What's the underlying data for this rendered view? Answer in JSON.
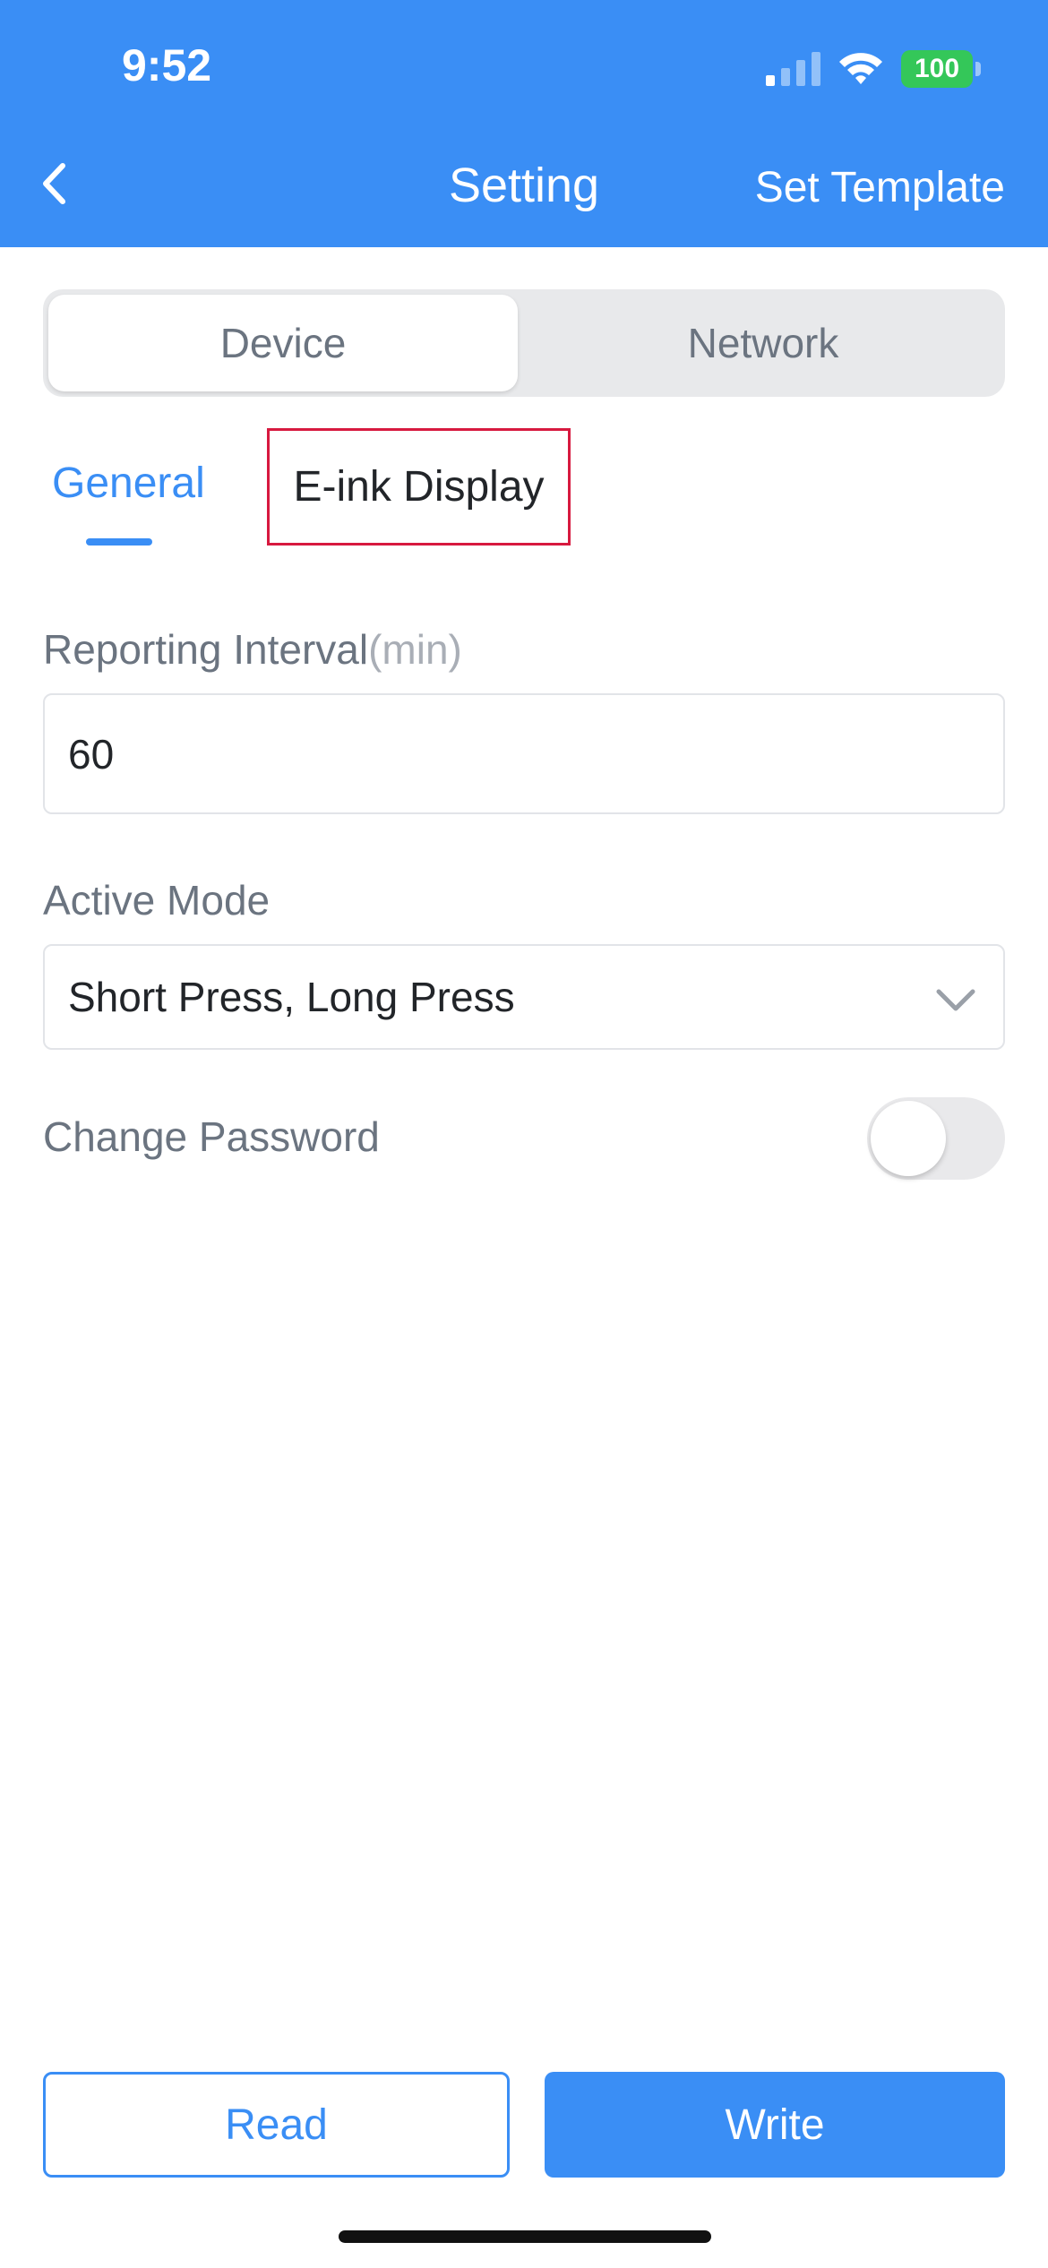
{
  "status_bar": {
    "time": "9:52",
    "battery": "100",
    "icons": [
      "signal-icon",
      "wifi-icon",
      "battery-icon"
    ]
  },
  "nav": {
    "back_icon": "chevron-left-icon",
    "title": "Setting",
    "action": "Set Template"
  },
  "segmented": {
    "items": [
      "Device",
      "Network"
    ],
    "selected": "Device"
  },
  "tabs": {
    "items": [
      "General",
      "E-ink Display"
    ],
    "selected": "General"
  },
  "form": {
    "reporting_interval": {
      "label": "Reporting Interval",
      "unit": "(min)",
      "value": "60"
    },
    "active_mode": {
      "label": "Active Mode",
      "value": "Short Press, Long Press",
      "icon": "chevron-down-icon"
    },
    "change_password": {
      "label": "Change Password",
      "enabled": false
    }
  },
  "buttons": {
    "read": "Read",
    "write": "Write"
  },
  "colors": {
    "primary": "#3a8ef5",
    "highlight_border": "#d7193f",
    "battery_green": "#34c759"
  }
}
